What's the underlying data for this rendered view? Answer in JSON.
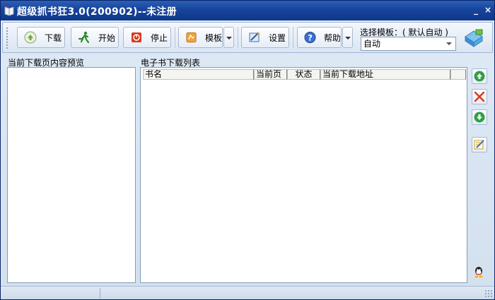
{
  "window": {
    "title": "超级抓书狂3.0(200902)--未注册",
    "minimize_glyph": "_",
    "close_glyph": "×"
  },
  "toolbar": {
    "download_label": "下载",
    "start_label": "开始",
    "stop_label": "停止",
    "template_label": "模板",
    "settings_label": "设置",
    "help_label": "帮助",
    "template_select_label": "选择模板：( 默认自动 )",
    "template_select_value": "自动"
  },
  "preview": {
    "label": "当前下载页内容预览"
  },
  "list": {
    "label": "电子书下载列表",
    "columns": [
      "书名",
      "当前页",
      "状态",
      "当前下载地址",
      ""
    ]
  },
  "icons": {
    "app": "book-icon",
    "download": "download-icon",
    "start": "run-icon",
    "stop": "stop-icon",
    "template": "template-icon",
    "settings": "settings-icon",
    "help": "help-icon",
    "logo": "gem-logo-icon",
    "move_up": "arrow-up-icon",
    "delete": "delete-icon",
    "move_down": "arrow-down-icon",
    "edit": "edit-icon",
    "qq": "qq-icon"
  },
  "colors": {
    "title_bar": "#17449b",
    "green": "#2ea043",
    "red": "#d9381e"
  }
}
